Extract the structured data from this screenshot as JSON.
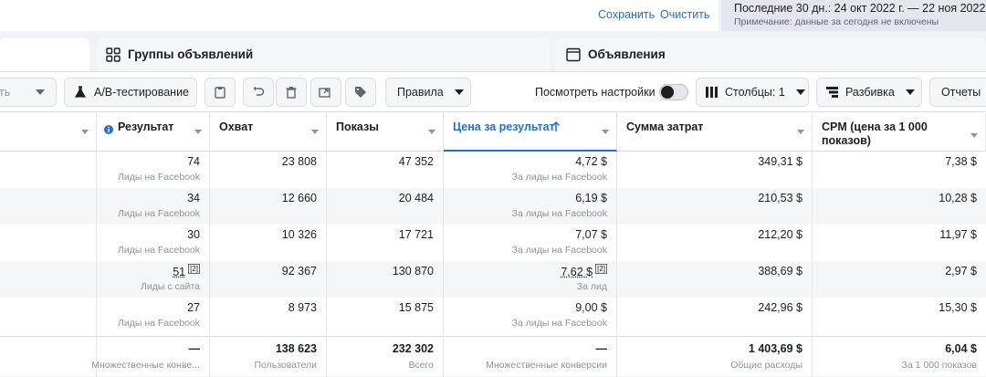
{
  "topbar": {
    "save": "Сохранить",
    "clear": "Очистить",
    "date_range": "Последние 30 дн.: 24 окт 2022 г. — 22 ноя 2022 г.",
    "date_note": "Примечание: данные за сегодня не включены"
  },
  "tabs": {
    "adsets": "Группы объявлений",
    "ads": "Объявления"
  },
  "toolbar": {
    "partial_label": "ть",
    "ab_test": "A/B-тестирование",
    "rules": "Правила",
    "view_settings": "Посмотреть настройки",
    "columns": "Столбцы: 1",
    "breakdown": "Разбивка",
    "reports": "Отчеты"
  },
  "columns": {
    "result": "Результат",
    "reach": "Охват",
    "impressions": "Показы",
    "cost_per_result": "Цена за результат",
    "amount_spent": "Сумма затрат",
    "cpm": "CPM (цена за 1 000 показов)"
  },
  "rows": [
    {
      "result": "74",
      "result_type": "Лиды на Facebook",
      "reach": "23 808",
      "impressions": "47 352",
      "cost": "4,72 $",
      "cost_type": "За лиды на Facebook",
      "spent": "349,31 $",
      "cpm": "7,38 $"
    },
    {
      "result": "34",
      "result_type": "Лиды на Facebook",
      "reach": "12 660",
      "impressions": "20 484",
      "cost": "6,19 $",
      "cost_type": "За лиды на Facebook",
      "spent": "210,53 $",
      "cpm": "10,28 $"
    },
    {
      "result": "30",
      "result_type": "Лиды на Facebook",
      "reach": "10 326",
      "impressions": "17 721",
      "cost": "7,07 $",
      "cost_type": "За лиды на Facebook",
      "spent": "212,20 $",
      "cpm": "11,97 $"
    },
    {
      "result": "51",
      "result_type": "Лиды с сайта",
      "reach": "92 367",
      "impressions": "130 870",
      "cost": "7,62 $",
      "cost_type": "За лид",
      "spent": "388,69 $",
      "cpm": "2,97 $",
      "footnote": "[2]"
    },
    {
      "result": "27",
      "result_type": "Лиды на Facebook",
      "reach": "8 973",
      "impressions": "15 875",
      "cost": "9,00 $",
      "cost_type": "За лиды на Facebook",
      "spent": "242,96 $",
      "cpm": "15,30 $"
    }
  ],
  "totals": {
    "result": "—",
    "result_type": "Множественные конве...",
    "reach": "138 623",
    "reach_type": "Пользователи",
    "impressions": "232 302",
    "impressions_type": "Всего",
    "cost": "—",
    "cost_type": "Множественные конверсии",
    "spent": "1 403,69 $",
    "spent_type": "Общие расходы",
    "cpm": "6,04 $",
    "cpm_type": "За 1 000 показов"
  },
  "colors": {
    "link": "#216fdb",
    "info": "#216fdb"
  }
}
